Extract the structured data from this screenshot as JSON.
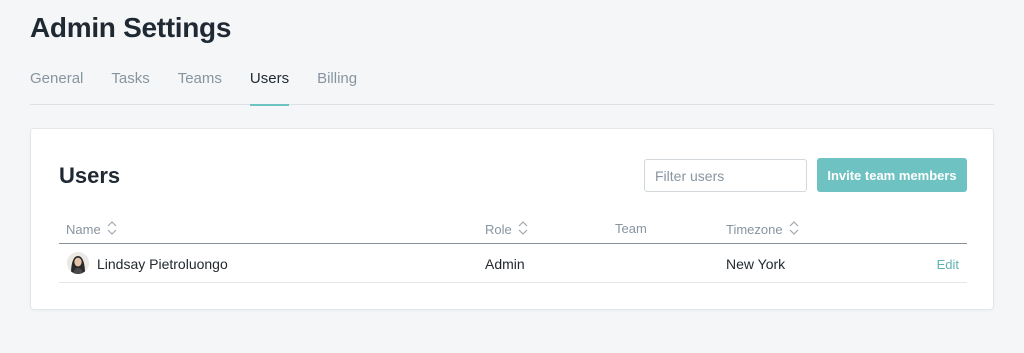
{
  "page": {
    "title": "Admin Settings"
  },
  "tabs": [
    {
      "label": "General"
    },
    {
      "label": "Tasks"
    },
    {
      "label": "Teams"
    },
    {
      "label": "Users"
    },
    {
      "label": "Billing"
    }
  ],
  "active_tab": "Users",
  "users_panel": {
    "title": "Users",
    "filter": {
      "placeholder": "Filter users",
      "value": ""
    },
    "invite_button": "Invite team members",
    "columns": {
      "name": "Name",
      "role": "Role",
      "team": "Team",
      "timezone": "Timezone"
    },
    "rows": [
      {
        "name": "Lindsay Pietroluongo",
        "role": "Admin",
        "team": "",
        "timezone": "New York",
        "action": "Edit"
      }
    ]
  },
  "colors": {
    "accent": "#6ec2c2",
    "link": "#5fb3b3",
    "background": "#f5f6f7",
    "muted": "#8795a1"
  },
  "icons": {
    "sort": "sort-arrows-icon",
    "avatar": "user-avatar"
  }
}
